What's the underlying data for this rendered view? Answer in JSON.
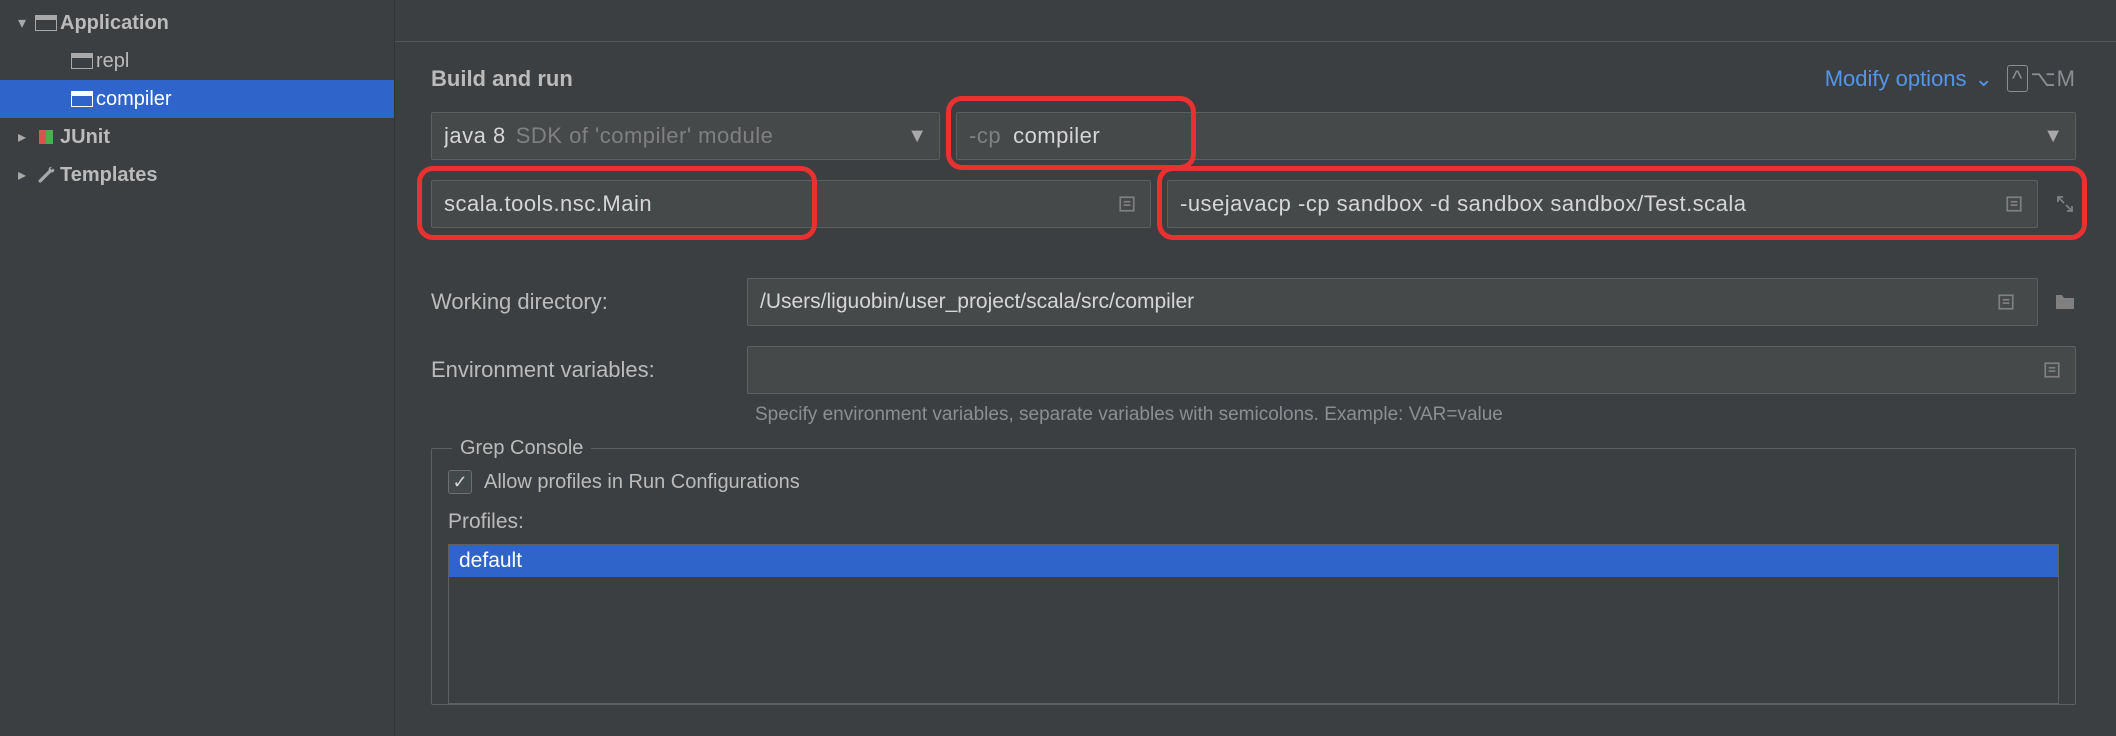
{
  "sidebar": {
    "nodes": [
      {
        "label": "Application",
        "depth": 0,
        "expanded": true,
        "icon": "app"
      },
      {
        "label": "repl",
        "depth": 1,
        "icon": "app"
      },
      {
        "label": "compiler",
        "depth": 1,
        "icon": "app",
        "selected": true
      },
      {
        "label": "JUnit",
        "depth": 0,
        "expandable": true,
        "icon": "junit"
      },
      {
        "label": "Templates",
        "depth": 0,
        "expandable": true,
        "icon": "wrench"
      }
    ]
  },
  "section_title": "Build and run",
  "modify_options_label": "Modify options",
  "modify_options_shortcut": "⌥M",
  "jdk": {
    "text": "java 8",
    "hint": "SDK of 'compiler' module"
  },
  "classpath": {
    "prefix": "-cp",
    "module": "compiler"
  },
  "main_class": "scala.tools.nsc.Main",
  "program_args": "-usejavacp -cp sandbox -d sandbox sandbox/Test.scala",
  "working_dir_label": "Working directory:",
  "working_dir": "/Users/liguobin/user_project/scala/src/compiler",
  "env_label": "Environment variables:",
  "env_value": "",
  "env_hint": "Specify environment variables, separate variables with semicolons. Example: VAR=value",
  "grep": {
    "legend": "Grep Console",
    "checkbox_label": "Allow profiles in Run Configurations",
    "checked": true,
    "profiles_label": "Profiles:",
    "profiles": [
      "default"
    ]
  }
}
